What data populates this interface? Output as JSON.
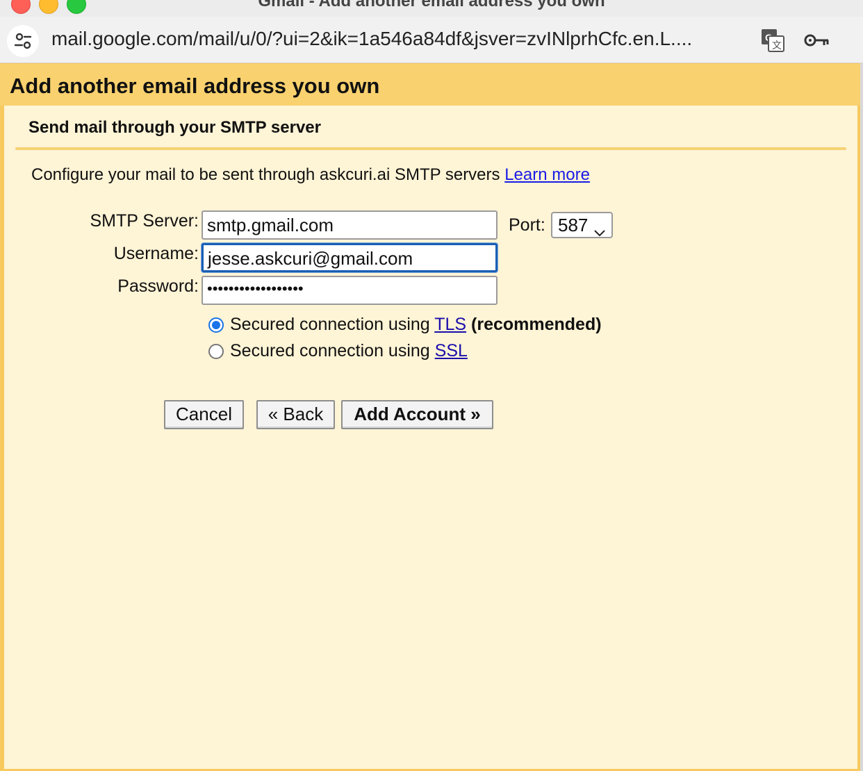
{
  "window": {
    "title": "Gmail - Add another email address you own"
  },
  "browser": {
    "url": "mail.google.com/mail/u/0/?ui=2&ik=1a546a84df&jsver=zvINlprhCfc.en.L...."
  },
  "dialog": {
    "title": "Add another email address you own",
    "subtitle": "Send mail through your SMTP server",
    "config_text": "Configure your mail to be sent through askcuri.ai SMTP servers",
    "learn_more": "Learn more"
  },
  "form": {
    "smtp_label": "SMTP Server:",
    "smtp_value": "smtp.gmail.com",
    "port_label": "Port:",
    "port_value": "587",
    "username_label": "Username:",
    "username_value": "jesse.askcuri@gmail.com",
    "password_label": "Password:",
    "password_value": "••••••••••••••••••",
    "tls_prefix": "Secured connection using",
    "tls_link": "TLS",
    "tls_suffix": "(recommended)",
    "ssl_prefix": "Secured connection using",
    "ssl_link": "SSL",
    "selected": "TLS"
  },
  "buttons": {
    "cancel": "Cancel",
    "back": "« Back",
    "add_account": "Add Account »"
  },
  "colors": {
    "header": "#f9d16e",
    "panel": "#fef4d6",
    "link": "#1a0dab",
    "radio_accent": "#1a73e8"
  },
  "icons": [
    "site-settings-icon",
    "translate-icon",
    "key-icon",
    "chevron-down-icon"
  ]
}
